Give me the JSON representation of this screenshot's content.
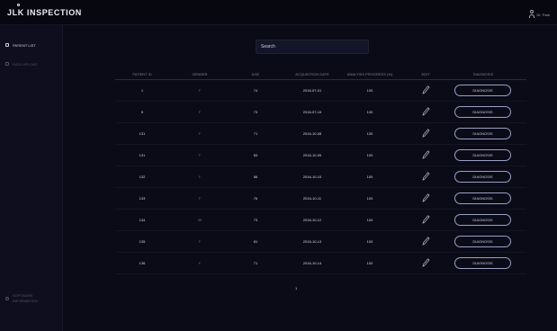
{
  "app": {
    "logo_text": "JLK INSPECTION",
    "user_name": "Dr. Park"
  },
  "sidebar": {
    "items": [
      {
        "label": "PATIENT LIST",
        "active": true
      },
      {
        "label": "DATA UPLOAD",
        "active": false
      }
    ],
    "footer_line1": "SOFTWARE",
    "footer_line2": "INFORMATION"
  },
  "search": {
    "placeholder": "Search"
  },
  "table": {
    "columns": [
      "PATIENT ID",
      "GENDER",
      "AGE",
      "ACQUISITION DATE",
      "ANALYSIS PROGRESS (%)",
      "EDIT",
      "DIAGNOSIS"
    ],
    "rows": [
      {
        "id": "1",
        "gender": "F",
        "age": "74",
        "date": "2016-07-01",
        "progress": "100",
        "diagnose": "DIAGNOSIS"
      },
      {
        "id": "5",
        "gender": "F",
        "age": "73",
        "date": "2016-07-15",
        "progress": "100",
        "diagnose": "DIAGNOSIS"
      },
      {
        "id": "131",
        "gender": "F",
        "age": "71",
        "date": "2016-10-08",
        "progress": "100",
        "diagnose": "DIAGNOSIS"
      },
      {
        "id": "131",
        "gender": "F",
        "age": "83",
        "date": "2016-10-09",
        "progress": "100",
        "diagnose": "DIAGNOSIS"
      },
      {
        "id": "132",
        "gender": "F",
        "age": "86",
        "date": "2016-10-10",
        "progress": "100",
        "diagnose": "DIAGNOSIS"
      },
      {
        "id": "133",
        "gender": "F",
        "age": "76",
        "date": "2016-10-11",
        "progress": "100",
        "diagnose": "DIAGNOSIS"
      },
      {
        "id": "134",
        "gender": "M",
        "age": "73",
        "date": "2016-10-12",
        "progress": "100",
        "diagnose": "DIAGNOSIS"
      },
      {
        "id": "135",
        "gender": "F",
        "age": "81",
        "date": "2016-10-13",
        "progress": "100",
        "diagnose": "DIAGNOSIS"
      },
      {
        "id": "136",
        "gender": "F",
        "age": "71",
        "date": "2016-10-14",
        "progress": "100",
        "diagnose": "DIAGNOSIS"
      }
    ]
  },
  "pagination": {
    "current_page": "1"
  },
  "colors": {
    "background": "#0b0b18",
    "topbar": "#07070f",
    "sidebar": "#0e0e1e",
    "gender_female": "#c23a5a",
    "gender_male": "#8c7bbd",
    "button_border": "#9aa0c4"
  },
  "icons": {
    "edit": "pencil-icon",
    "user": "user-icon",
    "patient_list": "list-icon",
    "upload": "upload-icon",
    "software_info": "info-icon"
  }
}
